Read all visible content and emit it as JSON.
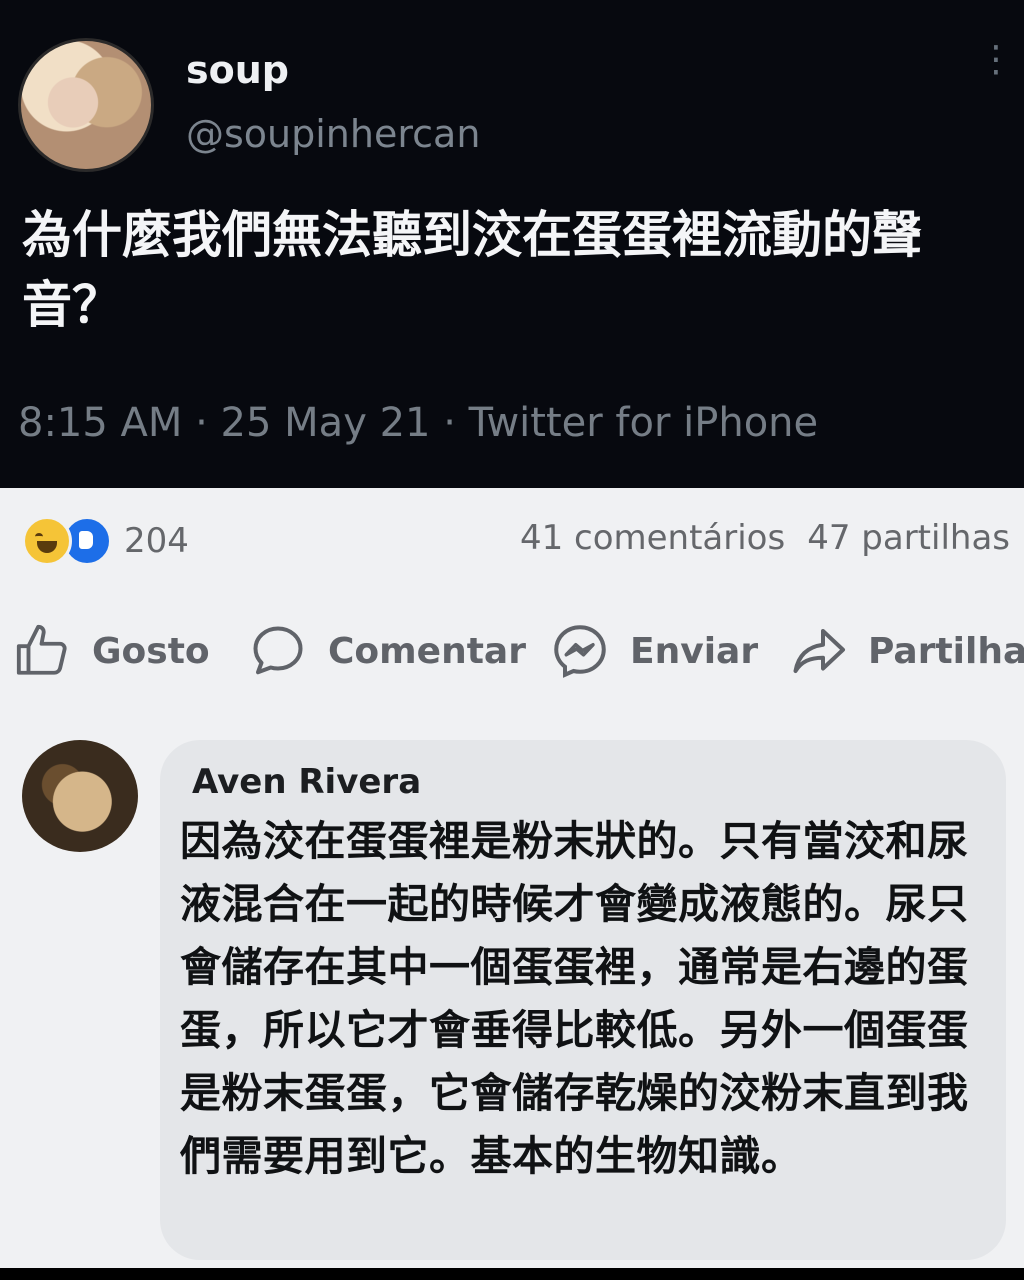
{
  "tweet": {
    "author_name": "soup",
    "handle": "@soupinhercan",
    "text": "為什麼我們無法聽到洨在蛋蛋裡流動的聲音？",
    "meta": "8:15 AM · 25 May 21 · Twitter for iPhone"
  },
  "fb": {
    "reaction_count": "204",
    "comments_count": "41 comentários",
    "shares_count": "47 partilhas",
    "actions": {
      "like": "Gosto",
      "comment": "Comentar",
      "send": "Enviar",
      "share": "Partilhar"
    },
    "comment": {
      "author": "Aven Rivera",
      "text": "因為洨在蛋蛋裡是粉末狀的。只有當洨和尿液混合在一起的時候才會變成液態的。尿只會儲存在其中一個蛋蛋裡，通常是右邊的蛋蛋，所以它才會垂得比較低。另外一個蛋蛋是粉末蛋蛋，它會儲存乾燥的洨粉末直到我們需要用到它。基本的生物知識。"
    }
  }
}
